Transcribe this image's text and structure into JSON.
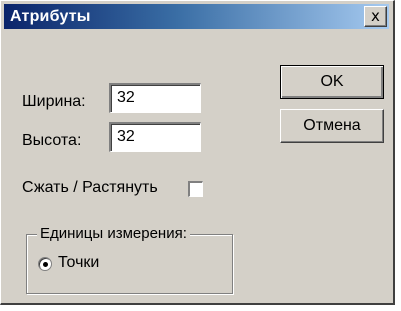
{
  "window": {
    "title": "Атрибуты",
    "close_glyph": "x"
  },
  "fields": {
    "width_label": "Ширина:",
    "width_value": "32",
    "height_label": "Высота:",
    "height_value": "32",
    "stretch_label": "Сжать / Растянуть",
    "stretch_checked": false
  },
  "buttons": {
    "ok_label": "OK",
    "cancel_label": "Отмена"
  },
  "units_group": {
    "legend": "Единицы измерения:",
    "option_label": "Точки",
    "option_selected": true
  },
  "icons": [
    "close-icon",
    "radio-dot-icon"
  ]
}
